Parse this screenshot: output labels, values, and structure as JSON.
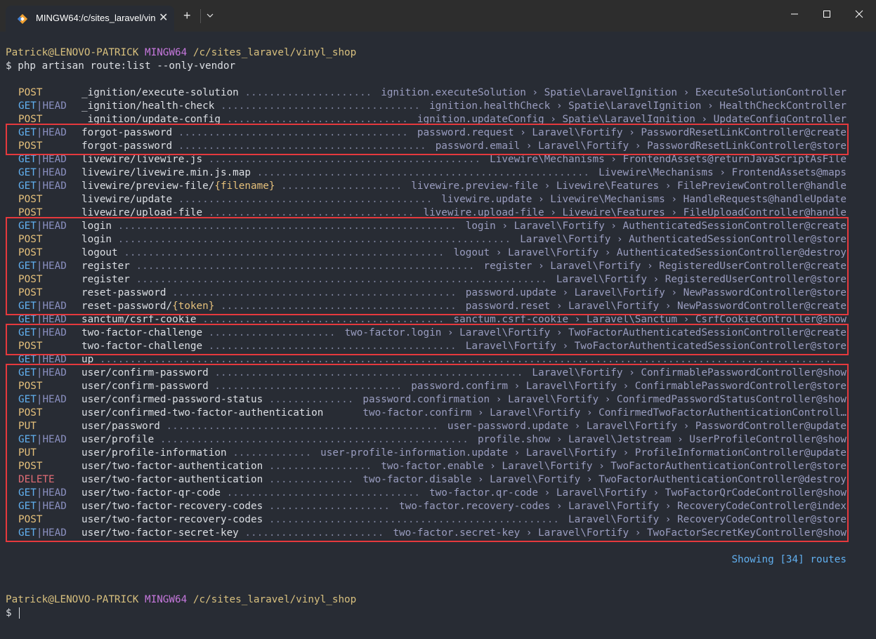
{
  "window": {
    "tab_title": "MINGW64:/c/sites_laravel/vin",
    "tab_icon": "git-bash-diamond-icon",
    "new_tab_label": "+",
    "close_tab_label": "✕",
    "controls": [
      "minimize",
      "maximize",
      "close"
    ]
  },
  "prompt1": {
    "user_host": "Patrick@LENOVO-PATRICK",
    "shell": "MINGW64",
    "path": "/c/sites_laravel/vinyl_shop",
    "symbol": "$",
    "command": "php artisan route:list --only-vendor"
  },
  "routes": [
    {
      "method": [
        "POST"
      ],
      "uri": "_ignition/execute-solution",
      "name": "ignition.executeSolution",
      "namespace": "Spatie\\LaravelIgnition",
      "action": "ExecuteSolutionController"
    },
    {
      "method": [
        "GET",
        "HEAD"
      ],
      "uri": "_ignition/health-check",
      "name": "ignition.healthCheck",
      "namespace": "Spatie\\LaravelIgnition",
      "action": "HealthCheckController"
    },
    {
      "method": [
        "POST"
      ],
      "uri": "_ignition/update-config",
      "name": "ignition.updateConfig",
      "namespace": "Spatie\\LaravelIgnition",
      "action": "UpdateConfigController"
    },
    {
      "method": [
        "GET",
        "HEAD"
      ],
      "uri": "forgot-password",
      "name": "password.request",
      "namespace": "Laravel\\Fortify",
      "action": "PasswordResetLinkController@create"
    },
    {
      "method": [
        "POST"
      ],
      "uri": "forgot-password",
      "name": "password.email",
      "namespace": "Laravel\\Fortify",
      "action": "PasswordResetLinkController@store"
    },
    {
      "method": [
        "GET",
        "HEAD"
      ],
      "uri": "livewire/livewire.js",
      "name": "",
      "namespace": "Livewire\\Mechanisms",
      "action": "FrontendAssets@returnJavaScriptAsFile"
    },
    {
      "method": [
        "GET",
        "HEAD"
      ],
      "uri": "livewire/livewire.min.js.map",
      "name": "",
      "namespace": "Livewire\\Mechanisms",
      "action": "FrontendAssets@maps"
    },
    {
      "method": [
        "GET",
        "HEAD"
      ],
      "uri": "livewire/preview-file/",
      "param": "{filename}",
      "name": "livewire.preview-file",
      "namespace": "Livewire\\Features",
      "action": "FilePreviewController@handle"
    },
    {
      "method": [
        "POST"
      ],
      "uri": "livewire/update",
      "name": "livewire.update",
      "namespace": "Livewire\\Mechanisms",
      "action": "HandleRequests@handleUpdate"
    },
    {
      "method": [
        "POST"
      ],
      "uri": "livewire/upload-file",
      "name": "livewire.upload-file",
      "namespace": "Livewire\\Features",
      "action": "FileUploadController@handle"
    },
    {
      "method": [
        "GET",
        "HEAD"
      ],
      "uri": "login",
      "name": "login",
      "namespace": "Laravel\\Fortify",
      "action": "AuthenticatedSessionController@create"
    },
    {
      "method": [
        "POST"
      ],
      "uri": "login",
      "name": "",
      "namespace": "Laravel\\Fortify",
      "action": "AuthenticatedSessionController@store"
    },
    {
      "method": [
        "POST"
      ],
      "uri": "logout",
      "name": "logout",
      "namespace": "Laravel\\Fortify",
      "action": "AuthenticatedSessionController@destroy"
    },
    {
      "method": [
        "GET",
        "HEAD"
      ],
      "uri": "register",
      "name": "register",
      "namespace": "Laravel\\Fortify",
      "action": "RegisteredUserController@create"
    },
    {
      "method": [
        "POST"
      ],
      "uri": "register",
      "name": "",
      "namespace": "Laravel\\Fortify",
      "action": "RegisteredUserController@store"
    },
    {
      "method": [
        "POST"
      ],
      "uri": "reset-password",
      "name": "password.update",
      "namespace": "Laravel\\Fortify",
      "action": "NewPasswordController@store"
    },
    {
      "method": [
        "GET",
        "HEAD"
      ],
      "uri": "reset-password/",
      "param": "{token}",
      "name": "password.reset",
      "namespace": "Laravel\\Fortify",
      "action": "NewPasswordController@create"
    },
    {
      "method": [
        "GET",
        "HEAD"
      ],
      "uri": "sanctum/csrf-cookie",
      "name": "sanctum.csrf-cookie",
      "namespace": "Laravel\\Sanctum",
      "action": "CsrfCookieController@show"
    },
    {
      "method": [
        "GET",
        "HEAD"
      ],
      "uri": "two-factor-challenge",
      "name": "two-factor.login",
      "namespace": "Laravel\\Fortify",
      "action": "TwoFactorAuthenticatedSessionController@create"
    },
    {
      "method": [
        "POST"
      ],
      "uri": "two-factor-challenge",
      "name": "",
      "namespace": "Laravel\\Fortify",
      "action": "TwoFactorAuthenticatedSessionController@store"
    },
    {
      "method": [
        "GET",
        "HEAD"
      ],
      "uri": "up",
      "name": "",
      "namespace": "",
      "action": ""
    },
    {
      "method": [
        "GET",
        "HEAD"
      ],
      "uri": "user/confirm-password",
      "name": "",
      "namespace": "Laravel\\Fortify",
      "action": "ConfirmablePasswordController@show"
    },
    {
      "method": [
        "POST"
      ],
      "uri": "user/confirm-password",
      "name": "password.confirm",
      "namespace": "Laravel\\Fortify",
      "action": "ConfirmablePasswordController@store"
    },
    {
      "method": [
        "GET",
        "HEAD"
      ],
      "uri": "user/confirmed-password-status",
      "name": "password.confirmation",
      "namespace": "Laravel\\Fortify",
      "action": "ConfirmedPasswordStatusController@show"
    },
    {
      "method": [
        "POST"
      ],
      "uri": "user/confirmed-two-factor-authentication",
      "name": "two-factor.confirm",
      "namespace": "Laravel\\Fortify",
      "action": "ConfirmedTwoFactorAuthenticationControll…",
      "nodots": true
    },
    {
      "method": [
        "PUT"
      ],
      "uri": "user/password",
      "name": "user-password.update",
      "namespace": "Laravel\\Fortify",
      "action": "PasswordController@update"
    },
    {
      "method": [
        "GET",
        "HEAD"
      ],
      "uri": "user/profile",
      "name": "profile.show",
      "namespace": "Laravel\\Jetstream",
      "action": "UserProfileController@show"
    },
    {
      "method": [
        "PUT"
      ],
      "uri": "user/profile-information",
      "name": "user-profile-information.update",
      "namespace": "Laravel\\Fortify",
      "action": "ProfileInformationController@update"
    },
    {
      "method": [
        "POST"
      ],
      "uri": "user/two-factor-authentication",
      "name": "two-factor.enable",
      "namespace": "Laravel\\Fortify",
      "action": "TwoFactorAuthenticationController@store"
    },
    {
      "method": [
        "DELETE"
      ],
      "uri": "user/two-factor-authentication",
      "name": "two-factor.disable",
      "namespace": "Laravel\\Fortify",
      "action": "TwoFactorAuthenticationController@destroy"
    },
    {
      "method": [
        "GET",
        "HEAD"
      ],
      "uri": "user/two-factor-qr-code",
      "name": "two-factor.qr-code",
      "namespace": "Laravel\\Fortify",
      "action": "TwoFactorQrCodeController@show"
    },
    {
      "method": [
        "GET",
        "HEAD"
      ],
      "uri": "user/two-factor-recovery-codes",
      "name": "two-factor.recovery-codes",
      "namespace": "Laravel\\Fortify",
      "action": "RecoveryCodeController@index"
    },
    {
      "method": [
        "POST"
      ],
      "uri": "user/two-factor-recovery-codes",
      "name": "",
      "namespace": "Laravel\\Fortify",
      "action": "RecoveryCodeController@store"
    },
    {
      "method": [
        "GET",
        "HEAD"
      ],
      "uri": "user/two-factor-secret-key",
      "name": "two-factor.secret-key",
      "namespace": "Laravel\\Fortify",
      "action": "TwoFactorSecretKeyController@show"
    }
  ],
  "highlights": [
    {
      "from": 3,
      "to": 4
    },
    {
      "from": 10,
      "to": 16
    },
    {
      "from": 18,
      "to": 19
    },
    {
      "from": 21,
      "to": 33
    }
  ],
  "highlight_color": "#e5393d",
  "summary": "Showing [34] routes",
  "prompt2": {
    "user_host": "Patrick@LENOVO-PATRICK",
    "shell": "MINGW64",
    "path": "/c/sites_laravel/vinyl_shop",
    "symbol": "$"
  }
}
